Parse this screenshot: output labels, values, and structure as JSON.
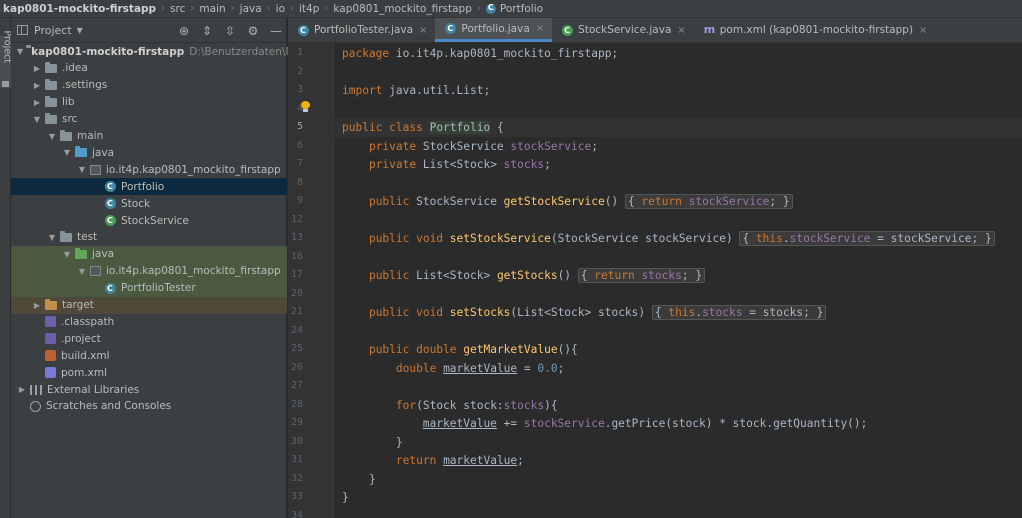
{
  "breadcrumbs": [
    "kap0801-mockito-firstapp",
    "src",
    "main",
    "java",
    "io",
    "it4p",
    "kap0801_mockito_firstapp",
    "Portfolio"
  ],
  "toolstrip": {
    "label": "Project"
  },
  "project_panel": {
    "title": "Project",
    "tree": [
      {
        "label": "kap0801-mockito-firstapp",
        "hint": "D:\\Benutzerdaten\\Merte",
        "indent": 0,
        "arrow": "down",
        "icon": "folder"
      },
      {
        "label": ".idea",
        "indent": 1,
        "arrow": "right",
        "icon": "folder"
      },
      {
        "label": ".settings",
        "indent": 1,
        "arrow": "right",
        "icon": "folder"
      },
      {
        "label": "lib",
        "indent": 1,
        "arrow": "right",
        "icon": "folder"
      },
      {
        "label": "src",
        "indent": 1,
        "arrow": "down",
        "icon": "folder"
      },
      {
        "label": "main",
        "indent": 2,
        "arrow": "down",
        "icon": "folder"
      },
      {
        "label": "java",
        "indent": 3,
        "arrow": "down",
        "icon": "folder-blue"
      },
      {
        "label": "io.it4p.kap0801_mockito_firstapp",
        "indent": 4,
        "arrow": "down",
        "icon": "package"
      },
      {
        "label": "Portfolio",
        "indent": 5,
        "arrow": "none",
        "icon": "class",
        "selected": true
      },
      {
        "label": "Stock",
        "indent": 5,
        "arrow": "none",
        "icon": "class"
      },
      {
        "label": "StockService",
        "indent": 5,
        "arrow": "none",
        "icon": "class-green"
      },
      {
        "label": "test",
        "indent": 2,
        "arrow": "down",
        "icon": "folder"
      },
      {
        "label": "java",
        "indent": 3,
        "arrow": "down",
        "icon": "folder-green",
        "test": true
      },
      {
        "label": "io.it4p.kap0801_mockito_firstapp",
        "indent": 4,
        "arrow": "down",
        "icon": "package",
        "test": true
      },
      {
        "label": "PortfolioTester",
        "indent": 5,
        "arrow": "none",
        "icon": "class",
        "test": true
      },
      {
        "label": "target",
        "indent": 1,
        "arrow": "right",
        "icon": "folder-orange",
        "target": true
      },
      {
        "label": ".classpath",
        "indent": 1,
        "arrow": "none",
        "icon": "file"
      },
      {
        "label": ".project",
        "indent": 1,
        "arrow": "none",
        "icon": "file"
      },
      {
        "label": "build.xml",
        "indent": 1,
        "arrow": "none",
        "icon": "file-xml"
      },
      {
        "label": "pom.xml",
        "indent": 1,
        "arrow": "none",
        "icon": "file-m"
      },
      {
        "label": "External Libraries",
        "indent": 0,
        "arrow": "right",
        "icon": "library"
      },
      {
        "label": "Scratches and Consoles",
        "indent": 0,
        "arrow": "none",
        "icon": "scratch"
      }
    ]
  },
  "tabs": [
    {
      "label": "PortfolioTester.java",
      "icon": "class-blue"
    },
    {
      "label": "Portfolio.java",
      "icon": "class-blue",
      "active": true
    },
    {
      "label": "StockService.java",
      "icon": "class-green"
    },
    {
      "label": "pom.xml (kap0801-mockito-firstapp)",
      "icon": "maven"
    }
  ],
  "editor": {
    "current_line": "5",
    "lines": [
      {
        "n": "1",
        "code": "<span class=\"kw\">package</span> io.it4p.kap0801_mockito_firstapp;"
      },
      {
        "n": "2",
        "code": ""
      },
      {
        "n": "3",
        "code": "<span class=\"kw\">import</span> java.util.List;"
      },
      {
        "n": "4",
        "code": ""
      },
      {
        "n": "5",
        "code": "<span class=\"kw\">public class</span> <span class=\"cur-cls\">Portfolio</span> {"
      },
      {
        "n": "6",
        "code": "    <span class=\"kw\">private</span> StockService <span class=\"fld\">stockService</span>;"
      },
      {
        "n": "7",
        "code": "    <span class=\"kw\">private</span> List&lt;Stock&gt; <span class=\"fld\">stocks</span>;"
      },
      {
        "n": "8",
        "code": ""
      },
      {
        "n": "9",
        "code": "    <span class=\"kw\">public</span> StockService <span class=\"mth\">getStockService</span>() <span class=\"fold\">{ <span class=\"kw\">return</span> <span class=\"fld\">stockService</span>; }</span>"
      },
      {
        "n": "12",
        "code": ""
      },
      {
        "n": "13",
        "code": "    <span class=\"kw\">public void</span> <span class=\"mth\">setStockService</span>(StockService stockService) <span class=\"fold\">{ <span class=\"kw\">this</span>.<span class=\"fld\">stockService</span> = stockService; }</span>"
      },
      {
        "n": "16",
        "code": ""
      },
      {
        "n": "17",
        "code": "    <span class=\"kw\">public</span> List&lt;Stock&gt; <span class=\"mth\">getStocks</span>() <span class=\"fold\">{ <span class=\"kw\">return</span> <span class=\"fld\">stocks</span>; }</span>"
      },
      {
        "n": "20",
        "code": ""
      },
      {
        "n": "21",
        "code": "    <span class=\"kw\">public void</span> <span class=\"mth\">setStocks</span>(List&lt;Stock&gt; stocks) <span class=\"fold\">{ <span class=\"kw\">this</span>.<span class=\"fld\">stocks</span> = stocks; }</span>"
      },
      {
        "n": "24",
        "code": ""
      },
      {
        "n": "25",
        "code": "    <span class=\"kw\">public double</span> <span class=\"mth\">getMarketValue</span>(){"
      },
      {
        "n": "26",
        "code": "        <span class=\"kw\">double</span> <span class=\"ul\">marketValue</span> = <span class=\"num\">0.0</span>;"
      },
      {
        "n": "27",
        "code": ""
      },
      {
        "n": "28",
        "code": "        <span class=\"kw\">for</span>(Stock stock:<span class=\"fld\">stocks</span>){"
      },
      {
        "n": "29",
        "code": "            <span class=\"ul\">marketValue</span> += <span class=\"fld\">stockService</span>.getPrice(stock) * stock.getQuantity();"
      },
      {
        "n": "30",
        "code": "        }"
      },
      {
        "n": "31",
        "code": "        <span class=\"kw\">return</span> <span class=\"ul\">marketValue</span>;"
      },
      {
        "n": "32",
        "code": "    }"
      },
      {
        "n": "33",
        "code": "}"
      },
      {
        "n": "34",
        "code": ""
      }
    ]
  }
}
